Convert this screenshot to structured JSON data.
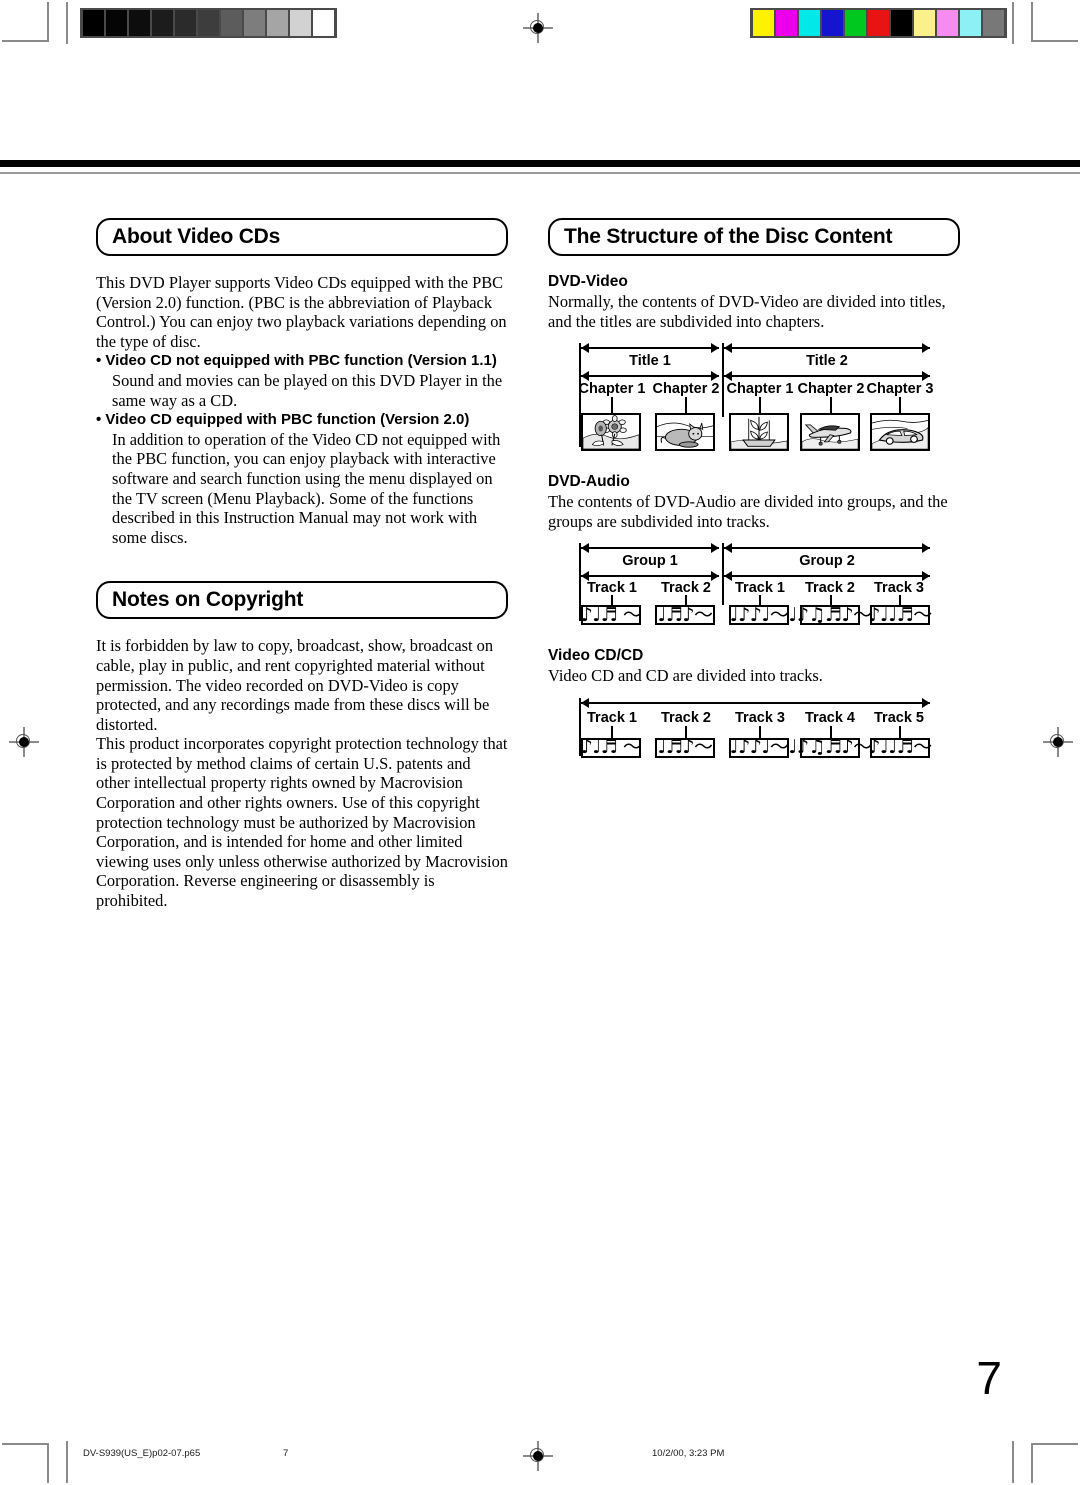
{
  "page": {
    "number": "7",
    "footer": {
      "filename": "DV-S939(US_E)p02-07.p65",
      "page_label": "7",
      "timestamp": "10/2/00, 3:23 PM"
    }
  },
  "calibration": {
    "grayscale_label": "grayscale-calibration-strip",
    "grayscale_patches": [
      "#000000",
      "#050505",
      "#0d0d0d",
      "#1c1c1c",
      "#2b2b2b",
      "#3d3d3d",
      "#5c5c5c",
      "#7d7d7d",
      "#a5a5a5",
      "#d2d2d2",
      "#ffffff"
    ],
    "color_label": "color-calibration-strip",
    "color_patches": [
      "#fff200",
      "#ec00ec",
      "#00e8e8",
      "#1515d0",
      "#00c81e",
      "#e81414",
      "#000000",
      "#faf08c",
      "#f78cf0",
      "#8cf0f5",
      "#787878"
    ]
  },
  "left_column": {
    "section_1": {
      "title": "About Video CDs",
      "intro": "This DVD Player supports Video CDs equipped with the PBC (Version 2.0) function. (PBC is the abbreviation of Playback Control.) You can enjoy two playback variations depending on the type of disc.",
      "bullets": [
        {
          "heading": "• Video CD not equipped with PBC function (Version 1.1)",
          "body": "Sound and movies can be played on this DVD Player in the same way as a CD."
        },
        {
          "heading": "• Video CD equipped with PBC function (Version 2.0)",
          "body": "In addition to operation of the Video CD not equipped with the PBC function, you can enjoy playback with interactive software and search function using the menu displayed on the TV screen (Menu Playback). Some of the functions described in this Instruction Manual may not work with some discs."
        }
      ]
    },
    "section_2": {
      "title": "Notes on Copyright",
      "paragraphs": [
        "It is forbidden by law to copy, broadcast, show, broadcast on cable, play in public, and rent copyrighted material without permission. The video recorded on DVD-Video is copy protected, and any recordings made from these discs will be distorted.",
        "This product incorporates copyright protection technology that is protected by method claims of certain U.S. patents and other intellectual property rights owned by Macrovision Corporation and other rights owners. Use of this copyright protection technology must be authorized by Macrovision Corporation, and is intended for home and other limited viewing uses only unless otherwise authorized by Macrovision Corporation. Reverse engineering or disassembly is prohibited."
      ]
    }
  },
  "right_column": {
    "title": "The Structure of the Disc Content",
    "subsections": [
      {
        "heading": "DVD-Video",
        "body": "Normally, the contents of DVD-Video are divided into titles, and the titles are subdivided into chapters.",
        "diagram": {
          "type": "dvd-video",
          "groups": [
            {
              "label": "Title 1",
              "segments": [
                "Chapter 1",
                "Chapter 2"
              ]
            },
            {
              "label": "Title 2",
              "segments": [
                "Chapter 1",
                "Chapter 2",
                "Chapter 3"
              ]
            }
          ],
          "thumbnails": [
            "sunflowers",
            "cat",
            "sailing-ship",
            "airplane",
            "car"
          ]
        }
      },
      {
        "heading": "DVD-Audio",
        "body": "The contents of DVD-Audio are divided into groups, and the groups are subdivided into tracks.",
        "diagram": {
          "type": "dvd-audio",
          "groups": [
            {
              "label": "Group 1",
              "segments": [
                "Track 1",
                "Track 2"
              ]
            },
            {
              "label": "Group 2",
              "segments": [
                "Track 1",
                "Track 2",
                "Track 3"
              ]
            }
          ],
          "note_boxes": [
            "♪♩♬ 〜",
            "♩♬♪〜",
            "♩♪♪♩〜",
            "♩♪♫♬♪〜",
            "♪♩♩♬〜"
          ]
        }
      },
      {
        "heading": "Video CD/CD",
        "body": "Video CD and CD are divided into tracks.",
        "diagram": {
          "type": "video-cd",
          "span_label": "",
          "segments": [
            "Track 1",
            "Track 2",
            "Track 3",
            "Track 4",
            "Track 5"
          ],
          "note_boxes": [
            "♪♩♬ 〜",
            "♩♬♪〜",
            "♩♪♪♩〜",
            "♩♪♫♬♪〜",
            "♪♩♩♬〜"
          ]
        }
      }
    ]
  }
}
